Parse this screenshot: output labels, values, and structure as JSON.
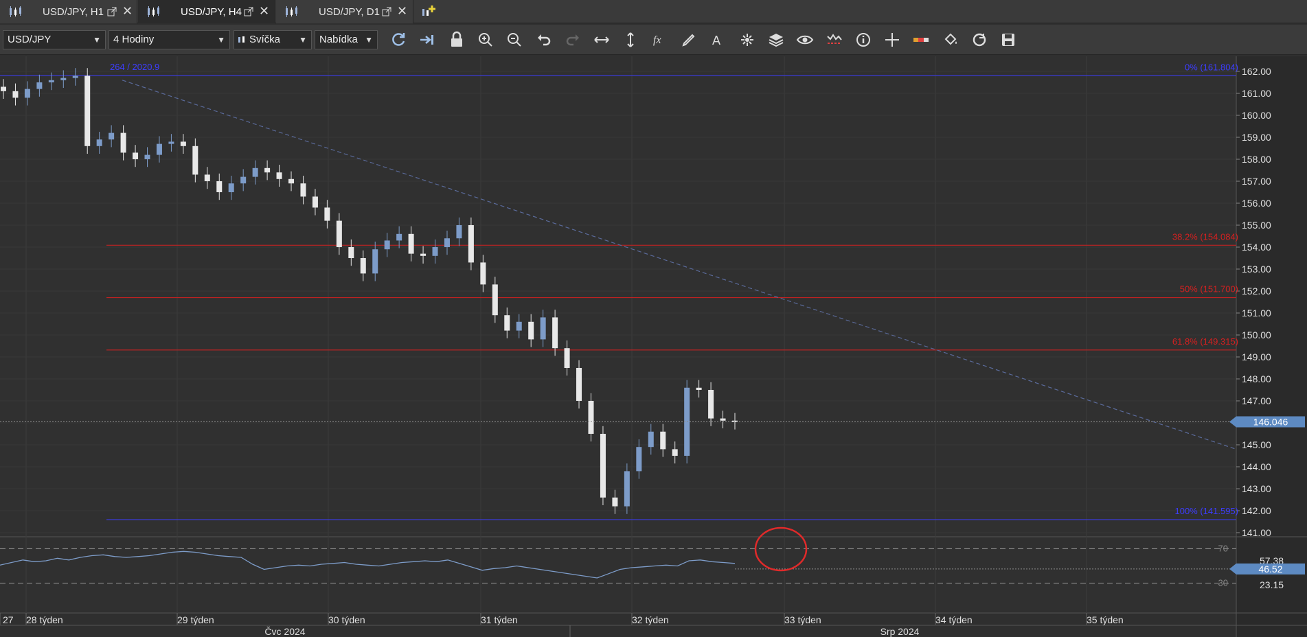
{
  "tabs": [
    {
      "label": "USD/JPY, H1",
      "active": false
    },
    {
      "label": "USD/JPY, H4",
      "active": true
    },
    {
      "label": "USD/JPY, D1",
      "active": false
    }
  ],
  "toolbar": {
    "symbol": "USD/JPY",
    "timeframe": "4 Hodiny",
    "chart_type": "Svíčka",
    "price_side": "Nabídka",
    "icons": [
      "refresh-icon",
      "autoscroll-icon",
      "lock-icon",
      "zoom-in-icon",
      "zoom-out-icon",
      "undo-icon",
      "redo-icon",
      "horizontal-scale-icon",
      "vertical-scale-icon",
      "indicators-icon",
      "draw-pencil-icon",
      "text-tool-icon",
      "objects-icon",
      "layers-icon",
      "visibility-icon",
      "alerts-icon",
      "info-icon",
      "crosshair-icon",
      "color-theme-icon",
      "fill-icon",
      "reset-icon",
      "save-icon"
    ]
  },
  "chart": {
    "top_left_label": "264 / 2020.9",
    "price_axis": [
      "162.00",
      "161.00",
      "160.00",
      "159.00",
      "158.00",
      "157.00",
      "156.00",
      "155.00",
      "154.00",
      "153.00",
      "152.00",
      "151.00",
      "150.00",
      "149.00",
      "148.00",
      "147.00",
      "146.00",
      "145.00",
      "144.00",
      "143.00",
      "142.00",
      "141.00"
    ],
    "current_price": "146.046",
    "fib_levels": [
      {
        "label": "0% (161.804)",
        "price": 161.804,
        "color": "#3d3dff"
      },
      {
        "label": "38.2% (154.084)",
        "price": 154.084,
        "color": "#d42020"
      },
      {
        "label": "50% (151.700)",
        "price": 151.7,
        "color": "#d42020"
      },
      {
        "label": "61.8% (149.315)",
        "price": 149.315,
        "color": "#d42020"
      },
      {
        "label": "100% (141.595)",
        "price": 141.595,
        "color": "#3d3dff"
      }
    ],
    "oscillator": {
      "levels": [
        "70",
        "30"
      ],
      "axis_labels": [
        "57.38",
        "23.15"
      ],
      "current": "46.52"
    },
    "time_axis": [
      "27",
      "28 týden",
      "29 týden",
      "30 týden",
      "31 týden",
      "32 týden",
      "33 týden",
      "34 týden",
      "35 týden"
    ],
    "month_axis": [
      "Čvc 2024",
      "Srp 2024"
    ],
    "colors": {
      "bull": "#7d9cc9",
      "bear": "#e8e8e8",
      "trendline": "#5a6a9a",
      "annotation_circle": "#e02a2a"
    }
  },
  "chart_data": {
    "type": "candlestick",
    "symbol": "USD/JPY",
    "timeframe": "H4",
    "ylim": [
      141.0,
      162.4
    ],
    "price_series_approx": [
      161.1,
      160.8,
      161.2,
      161.5,
      161.6,
      161.7,
      161.8,
      158.6,
      158.9,
      159.2,
      158.3,
      158.0,
      158.2,
      158.7,
      158.8,
      158.6,
      157.3,
      157.0,
      156.5,
      156.9,
      157.2,
      157.6,
      157.4,
      157.1,
      156.9,
      156.3,
      155.8,
      155.2,
      154.0,
      153.5,
      152.8,
      153.9,
      154.3,
      154.6,
      153.7,
      153.6,
      154.0,
      154.4,
      155.0,
      153.3,
      152.3,
      150.9,
      150.2,
      150.6,
      149.8,
      150.8,
      149.4,
      148.5,
      147.0,
      145.5,
      142.6,
      142.2,
      143.8,
      144.9,
      145.6,
      144.8,
      144.5,
      147.6,
      147.5,
      146.2,
      146.1,
      146.05
    ],
    "oscillator_series_approx": [
      51,
      54,
      57,
      55,
      56,
      59,
      57,
      60,
      62,
      63,
      61,
      60,
      61,
      62,
      64,
      66,
      67,
      66,
      64,
      62,
      61,
      60,
      52,
      46,
      48,
      50,
      51,
      50,
      52,
      53,
      54,
      52,
      51,
      50,
      52,
      54,
      55,
      56,
      55,
      57,
      53,
      49,
      45,
      47,
      48,
      50,
      48,
      46,
      44,
      42,
      40,
      38,
      36,
      41,
      46,
      48,
      49,
      50,
      51,
      50,
      56,
      57,
      55,
      54,
      53
    ]
  }
}
